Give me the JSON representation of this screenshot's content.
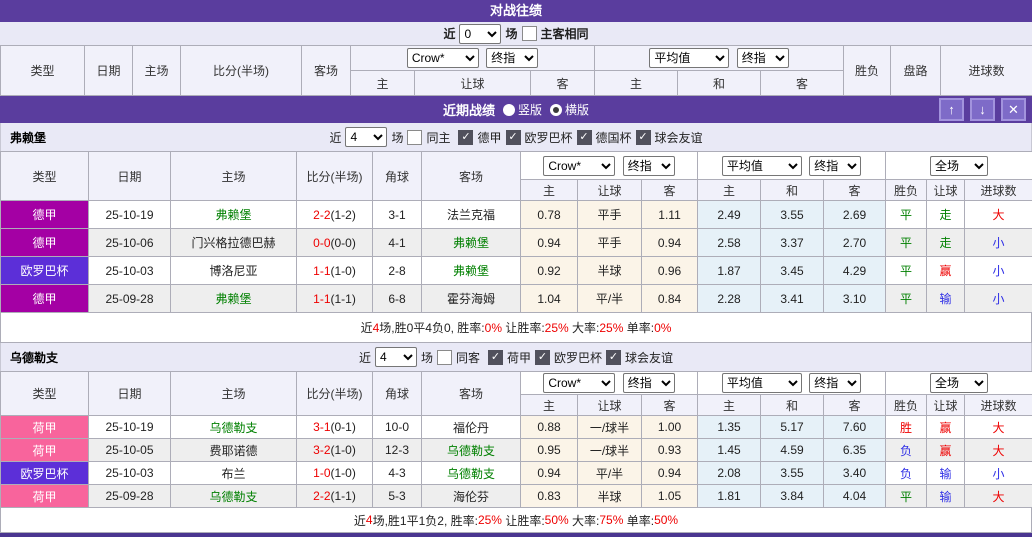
{
  "colors": {
    "header_purple": "#5A3D9E",
    "bottom_border": "#4A3590",
    "row_alt": "#EEEEEE",
    "odds_column_bg": "#FBF4E8",
    "avg_column_bg": "#E6F1F8",
    "section_bg": "#E9E9F6",
    "badge_bundesliga": "#A400A4",
    "badge_europa": "#5C2FD8",
    "badge_eredivisie": "#F8649C",
    "win_red": "#EE0000",
    "draw_green": "#008000",
    "lose_blue": "#2E2EE6"
  },
  "icons": {
    "check": "✓",
    "up": "↑",
    "down": "↓",
    "close": "✕"
  },
  "top_bar": {
    "title": "对战往绩"
  },
  "top_filter": {
    "recent": "近",
    "n": "0",
    "matches": "场",
    "same": "主客相同"
  },
  "th": {
    "type": "类型",
    "date": "日期",
    "home": "主场",
    "score": "比分(半场)",
    "corner": "角球",
    "away": "客场",
    "h": "主",
    "hcp": "让球",
    "a": "客",
    "d": "和",
    "result": "胜负",
    "road": "盘路",
    "goals": "进球数",
    "crow": "Crow*",
    "final": "终指",
    "avg": "平均值",
    "full": "全场"
  },
  "recent_bar": {
    "title": "近期战绩",
    "vertical": "竖版",
    "horizontal": "横版"
  },
  "freiburg": {
    "name": "弗赖堡",
    "filter": {
      "recent": "近",
      "n": "4",
      "matches": "场",
      "same": "同主",
      "leagues": [
        "德甲",
        "欧罗巴杯",
        "德国杯",
        "球会友谊"
      ]
    },
    "rows": [
      {
        "league": "德甲",
        "date": "25-10-19",
        "home": "弗赖堡",
        "score_ft": "2-2",
        "score_ht": "(1-2)",
        "corner": "3-1",
        "away": "法兰克福",
        "o1": "0.78",
        "o2": "平手",
        "o3": "1.11",
        "a1": "2.49",
        "a2": "3.55",
        "a3": "2.69",
        "r1": "平",
        "r2": "走",
        "r3": "大"
      },
      {
        "league": "德甲",
        "date": "25-10-06",
        "home": "门兴格拉德巴赫",
        "score_ft": "0-0",
        "score_ht": "(0-0)",
        "corner": "4-1",
        "away": "弗赖堡",
        "o1": "0.94",
        "o2": "平手",
        "o3": "0.94",
        "a1": "2.58",
        "a2": "3.37",
        "a3": "2.70",
        "r1": "平",
        "r2": "走",
        "r3": "小"
      },
      {
        "league": "欧罗巴杯",
        "date": "25-10-03",
        "home": "博洛尼亚",
        "score_ft": "1-1",
        "score_ht": "(1-0)",
        "corner": "2-8",
        "away": "弗赖堡",
        "o1": "0.92",
        "o2": "半球",
        "o3": "0.96",
        "a1": "1.87",
        "a2": "3.45",
        "a3": "4.29",
        "r1": "平",
        "r2": "赢",
        "r3": "小"
      },
      {
        "league": "德甲",
        "date": "25-09-28",
        "home": "弗赖堡",
        "score_ft": "1-1",
        "score_ht": "(1-1)",
        "corner": "6-8",
        "away": "霍芬海姆",
        "o1": "1.04",
        "o2": "平/半",
        "o3": "0.84",
        "a1": "2.28",
        "a2": "3.41",
        "a3": "3.10",
        "r1": "平",
        "r2": "输",
        "r3": "小"
      }
    ],
    "summary": {
      "p1": "近",
      "n": "4",
      "p2": "场,胜0平4负0, 胜率:",
      "v1": "0%",
      "p3": " 让胜率:",
      "v2": "25%",
      "p4": " 大率:",
      "v3": "25%",
      "p5": " 单率:",
      "v4": "0%"
    }
  },
  "utrecht": {
    "name": "乌德勒支",
    "filter": {
      "recent": "近",
      "n": "4",
      "matches": "场",
      "same": "同客",
      "leagues": [
        "荷甲",
        "欧罗巴杯",
        "球会友谊"
      ]
    },
    "rows": [
      {
        "league": "荷甲",
        "date": "25-10-19",
        "home": "乌德勒支",
        "score_ft": "3-1",
        "score_ht": "(0-1)",
        "corner": "10-0",
        "away": "福伦丹",
        "o1": "0.88",
        "o2": "一/球半",
        "o3": "1.00",
        "a1": "1.35",
        "a2": "5.17",
        "a3": "7.60",
        "r1": "胜",
        "r2": "赢",
        "r3": "大"
      },
      {
        "league": "荷甲",
        "date": "25-10-05",
        "home": "费耶诺德",
        "score_ft": "3-2",
        "score_ht": "(1-0)",
        "corner": "12-3",
        "away": "乌德勒支",
        "o1": "0.95",
        "o2": "一/球半",
        "o3": "0.93",
        "a1": "1.45",
        "a2": "4.59",
        "a3": "6.35",
        "r1": "负",
        "r2": "赢",
        "r3": "大"
      },
      {
        "league": "欧罗巴杯",
        "date": "25-10-03",
        "home": "布兰",
        "score_ft": "1-0",
        "score_ht": "(1-0)",
        "corner": "4-3",
        "away": "乌德勒支",
        "o1": "0.94",
        "o2": "平/半",
        "o3": "0.94",
        "a1": "2.08",
        "a2": "3.55",
        "a3": "3.40",
        "r1": "负",
        "r2": "输",
        "r3": "小"
      },
      {
        "league": "荷甲",
        "date": "25-09-28",
        "home": "乌德勒支",
        "score_ft": "2-2",
        "score_ht": "(1-1)",
        "corner": "5-3",
        "away": "海伦芬",
        "o1": "0.83",
        "o2": "半球",
        "o3": "1.05",
        "a1": "1.81",
        "a2": "3.84",
        "a3": "4.04",
        "r1": "平",
        "r2": "输",
        "r3": "大"
      }
    ],
    "summary": {
      "p1": "近",
      "n": "4",
      "p2": "场,胜1平1负2, 胜率:",
      "v1": "25%",
      "p3": " 让胜率:",
      "v2": "50%",
      "p4": " 大率:",
      "v3": "75%",
      "p5": " 单率:",
      "v4": "50%"
    }
  }
}
